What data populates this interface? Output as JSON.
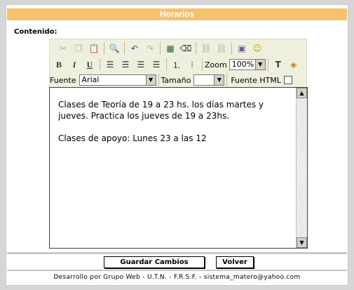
{
  "header": {
    "title": "Horarios"
  },
  "form": {
    "content_label": "Contenido:"
  },
  "toolbar": {
    "bold": "B",
    "italic": "I",
    "underline": "U",
    "font_label": "Fuente",
    "font_value": "Arial",
    "size_label": "Tamaño",
    "size_value": "",
    "zoom_label": "Zoom",
    "zoom_value": "100%",
    "html_label": "Fuente HTML"
  },
  "content": {
    "paragraphs": [
      "Clases de Teoría de 19 a 23 hs. los días martes y jueves. Practica los jueves de 19  a 23hs.",
      "Clases de apoyo: Lunes 23 a las 12"
    ]
  },
  "buttons": {
    "save": "Guardar Cambios",
    "back": "Volver"
  },
  "footer": {
    "text": "Desarrollo por Grupo Web - U.T.N. - F.R.S.F. - sistema_matero@yahoo.com"
  }
}
